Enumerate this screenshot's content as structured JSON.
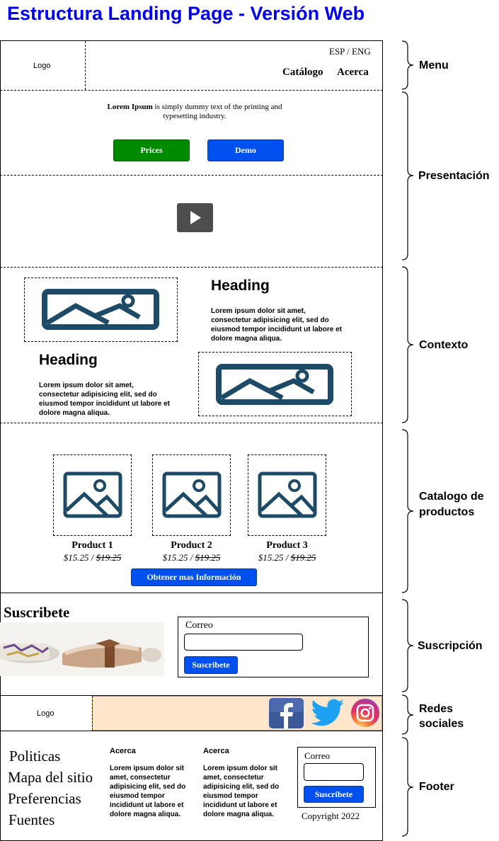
{
  "title": "Estructura Landing Page - Versión Web",
  "menu": {
    "logo": "Logo",
    "lang": "ESP / ENG",
    "links": [
      "Catálogo",
      "Acerca"
    ]
  },
  "presentation": {
    "text_bold": "Lorem Ipsum",
    "text_rest": " is simply dummy text of the printing and typesetting industry.",
    "prices_button": "Prices",
    "demo_button": "Demo",
    "video_icon": "play-icon"
  },
  "context": {
    "heading1": "Heading",
    "text1": "Lorem ipsum dolor sit amet, consectetur adipisicing elit, sed do eiusmod tempor incididunt ut labore et dolore magna aliqua.",
    "heading2": "Heading",
    "text2": "Lorem ipsum dolor sit amet, consectetur adipisicing elit, sed do eiusmod tempor incididunt ut labore et dolore magna aliqua.",
    "image_icon": "image-icon"
  },
  "catalog": {
    "products": [
      {
        "name": "Product 1",
        "price": "$15.25",
        "sep": " / ",
        "old_price": "$19.25"
      },
      {
        "name": "Product 2",
        "price": "$15.25",
        "sep": " / ",
        "old_price": "$19.25"
      },
      {
        "name": "Product 3",
        "price": "$15.25",
        "sep": " / ",
        "old_price": "$19.25"
      }
    ],
    "info_button": "Obtener mas Información"
  },
  "subscription": {
    "title": "Suscribete",
    "email_label": "Correo",
    "subscribe_button": "Suscribete"
  },
  "social": {
    "logo": "Logo",
    "bg_color": "#ffe6cc",
    "icons": [
      "facebook-icon",
      "twitter-icon",
      "instagram-icon"
    ]
  },
  "footer": {
    "links": [
      "Politicas",
      "Mapa del sitio",
      "Preferencias",
      "Fuentes"
    ],
    "col1_title": "Acerca",
    "col1_text": "Lorem ipsum dolor sit amet, consectetur adipisicing elit, sed do eiusmod tempor incididunt ut labore et dolore magna aliqua.",
    "col2_title": "Acerca",
    "col2_text": "Lorem ipsum dolor sit amet, consectetur adipisicing elit, sed do eiusmod tempor incididunt ut labore et dolore magna aliqua.",
    "email_label": "Correo",
    "subscribe_button": "Suscribete",
    "copyright": "Copyright 2022"
  },
  "section_labels": {
    "menu": "Menu",
    "presentation": "Presentación",
    "context": "Contexto",
    "catalog": "Catalogo de productos",
    "subscription": "Suscripción",
    "social": "Redes sociales",
    "footer": "Footer"
  }
}
